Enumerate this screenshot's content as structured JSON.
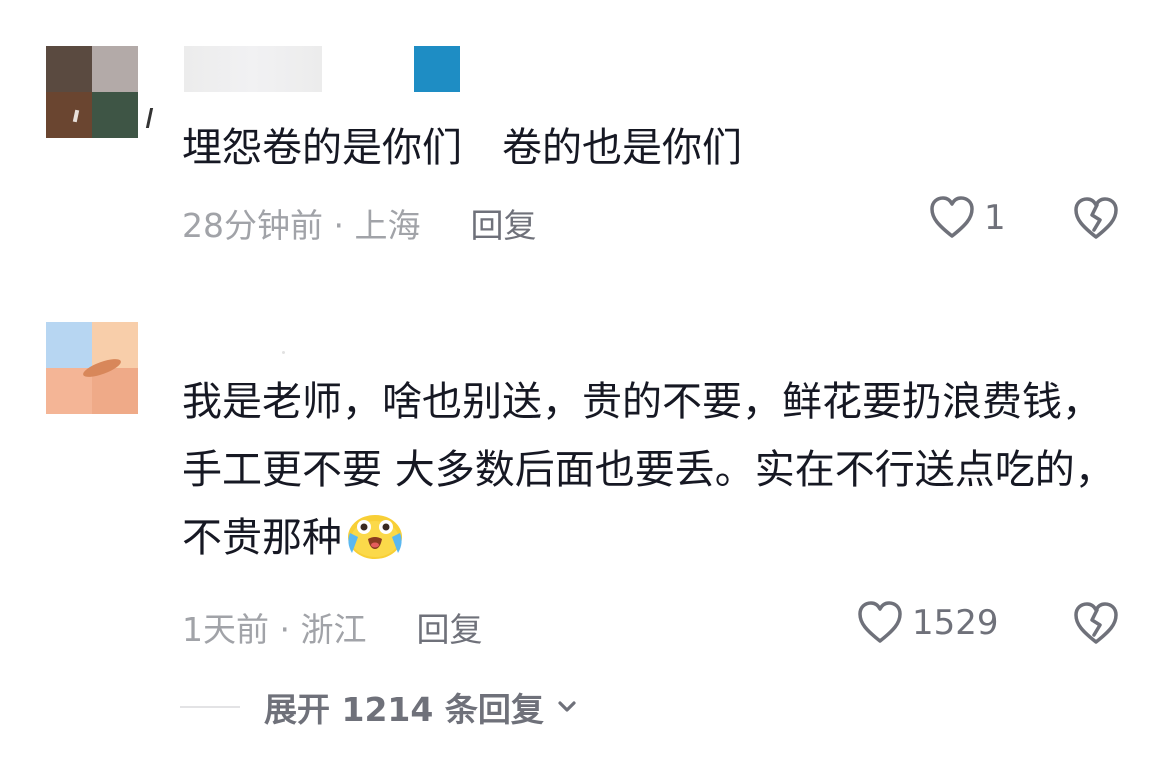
{
  "comments": [
    {
      "text": "埋怨卷的是你们　卷的也是你们",
      "time": "28分钟前",
      "location": "上海",
      "reply_label": "回复",
      "likes": "1",
      "avatar_colors": [
        "#5a4a40",
        "#b3aaa8",
        "#6a4530",
        "#3e5545"
      ],
      "badge_color": "#1e8dc4"
    },
    {
      "text": "我是老师，啥也别送，贵的不要，鲜花要扔浪费钱，手工更不要 大多数后面也要丢。实在不行送点吃的，不贵那种",
      "emoji": "crying-face-emoji",
      "time": "1天前",
      "location": "浙江",
      "reply_label": "回复",
      "likes": "1529",
      "avatar_colors": [
        "#b7d6f2",
        "#f8ceaa",
        "#f4b596",
        "#efaa88"
      ],
      "expand_label": "展开 1214 条回复"
    }
  ],
  "meta_separator": " · ",
  "icons": {
    "like": "heart-outline-icon",
    "dislike": "broken-heart-icon",
    "expand": "chevron-down-icon"
  },
  "colors": {
    "text": "#161823",
    "meta": "#a1a3a8",
    "action": "#6f717a"
  }
}
